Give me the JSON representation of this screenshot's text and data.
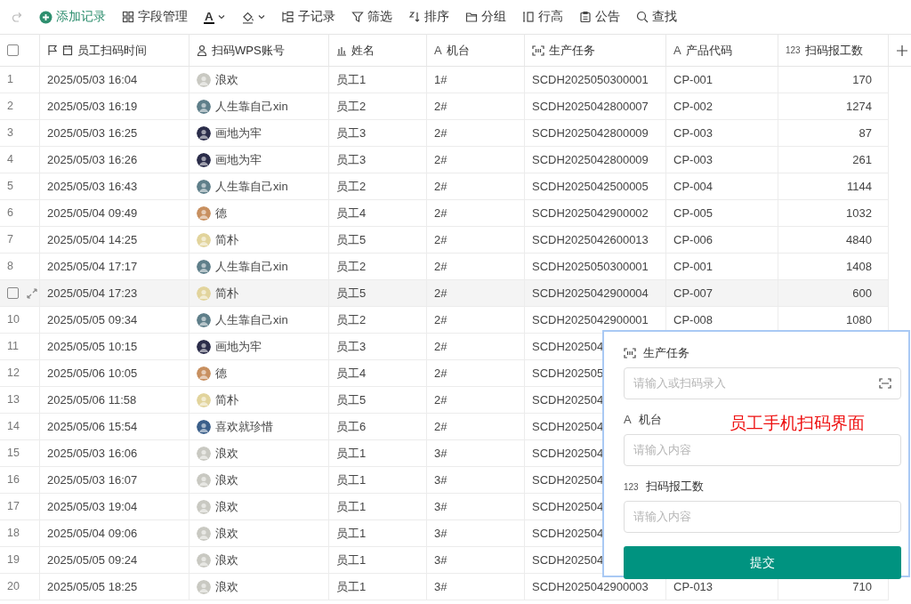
{
  "toolbar": [
    {
      "kind": "redo",
      "disabled": true
    },
    {
      "kind": "add",
      "label": "添加记录"
    },
    {
      "kind": "fields",
      "label": "字段管理"
    },
    {
      "kind": "text-color",
      "glyph": "A"
    },
    {
      "kind": "fill-color"
    },
    {
      "kind": "subrecord",
      "label": "子记录"
    },
    {
      "kind": "filter",
      "label": "筛选"
    },
    {
      "kind": "sort",
      "label": "排序"
    },
    {
      "kind": "group",
      "label": "分组"
    },
    {
      "kind": "row-height",
      "label": "行高"
    },
    {
      "kind": "notice",
      "label": "公告"
    },
    {
      "kind": "search",
      "label": "查找"
    }
  ],
  "table": {
    "all_selected": false,
    "columns": [
      {
        "kind": "date",
        "label": "员工扫码时间"
      },
      {
        "kind": "person",
        "label": "扫码WPS账号"
      },
      {
        "kind": "chart",
        "label": "姓名"
      },
      {
        "kind": "text",
        "icon_text": "A",
        "label": "机台"
      },
      {
        "kind": "scan",
        "label": "生产任务"
      },
      {
        "kind": "text",
        "icon_text": "A",
        "label": "产品代码"
      },
      {
        "kind": "number",
        "icon_text": "123",
        "label": "扫码报工数"
      }
    ],
    "rows": [
      {
        "num": "1",
        "hovered": false,
        "time": "2025/05/03 16:04",
        "account": {
          "name": "浪欢",
          "color": "#c9c9c2"
        },
        "name": "员工1",
        "machine": "1#",
        "task": "SCDH2025050300001",
        "product": "CP-001",
        "count": "170"
      },
      {
        "num": "2",
        "hovered": false,
        "time": "2025/05/03 16:19",
        "account": {
          "name": "人生靠自己xin",
          "color": "#5f7f8a"
        },
        "name": "员工2",
        "machine": "2#",
        "task": "SCDH2025042800007",
        "product": "CP-002",
        "count": "1274"
      },
      {
        "num": "3",
        "hovered": false,
        "time": "2025/05/03 16:25",
        "account": {
          "name": "画地为牢",
          "color": "#2b2d4a"
        },
        "name": "员工3",
        "machine": "2#",
        "task": "SCDH2025042800009",
        "product": "CP-003",
        "count": "87"
      },
      {
        "num": "4",
        "hovered": false,
        "time": "2025/05/03 16:26",
        "account": {
          "name": "画地为牢",
          "color": "#2b2d4a"
        },
        "name": "员工3",
        "machine": "2#",
        "task": "SCDH2025042800009",
        "product": "CP-003",
        "count": "261"
      },
      {
        "num": "5",
        "hovered": false,
        "time": "2025/05/03 16:43",
        "account": {
          "name": "人生靠自己xin",
          "color": "#5f7f8a"
        },
        "name": "员工2",
        "machine": "2#",
        "task": "SCDH2025042500005",
        "product": "CP-004",
        "count": "1144"
      },
      {
        "num": "6",
        "hovered": false,
        "time": "2025/05/04 09:49",
        "account": {
          "name": "德",
          "color": "#c89060"
        },
        "name": "员工4",
        "machine": "2#",
        "task": "SCDH2025042900002",
        "product": "CP-005",
        "count": "1032"
      },
      {
        "num": "7",
        "hovered": false,
        "time": "2025/05/04 14:25",
        "account": {
          "name": "简朴",
          "color": "#e2d49c"
        },
        "name": "员工5",
        "machine": "2#",
        "task": "SCDH2025042600013",
        "product": "CP-006",
        "count": "4840"
      },
      {
        "num": "8",
        "hovered": false,
        "time": "2025/05/04 17:17",
        "account": {
          "name": "人生靠自己xin",
          "color": "#5f7f8a"
        },
        "name": "员工2",
        "machine": "2#",
        "task": "SCDH2025050300001",
        "product": "CP-001",
        "count": "1408"
      },
      {
        "hovered": true,
        "time": "2025/05/04 17:23",
        "account": {
          "name": "简朴",
          "color": "#e2d49c"
        },
        "name": "员工5",
        "machine": "2#",
        "task": "SCDH2025042900004",
        "product": "CP-007",
        "count": "600"
      },
      {
        "num": "10",
        "hovered": false,
        "time": "2025/05/05 09:34",
        "account": {
          "name": "人生靠自己xin",
          "color": "#5f7f8a"
        },
        "name": "员工2",
        "machine": "2#",
        "task": "SCDH2025042900001",
        "product": "CP-008",
        "count": "1080"
      },
      {
        "num": "11",
        "hovered": false,
        "time": "2025/05/05 10:15",
        "account": {
          "name": "画地为牢",
          "color": "#2b2d4a"
        },
        "name": "员工3",
        "machine": "2#",
        "task": "SCDH202504"
      },
      {
        "num": "12",
        "hovered": false,
        "time": "2025/05/06 10:05",
        "account": {
          "name": "德",
          "color": "#c89060"
        },
        "name": "员工4",
        "machine": "2#",
        "task": "SCDH202505"
      },
      {
        "num": "13",
        "hovered": false,
        "time": "2025/05/06 11:58",
        "account": {
          "name": "简朴",
          "color": "#e2d49c"
        },
        "name": "员工5",
        "machine": "2#",
        "task": "SCDH202504"
      },
      {
        "num": "14",
        "hovered": false,
        "time": "2025/05/06 15:54",
        "account": {
          "name": "喜欢就珍惜",
          "color": "#3b5f8a"
        },
        "name": "员工6",
        "machine": "2#",
        "task": "SCDH202504"
      },
      {
        "num": "15",
        "hovered": false,
        "time": "2025/05/03 16:06",
        "account": {
          "name": "浪欢",
          "color": "#c9c9c2"
        },
        "name": "员工1",
        "machine": "3#",
        "task": "SCDH202504"
      },
      {
        "num": "16",
        "hovered": false,
        "time": "2025/05/03 16:07",
        "account": {
          "name": "浪欢",
          "color": "#c9c9c2"
        },
        "name": "员工1",
        "machine": "3#",
        "task": "SCDH202504"
      },
      {
        "num": "17",
        "hovered": false,
        "time": "2025/05/03 19:04",
        "account": {
          "name": "浪欢",
          "color": "#c9c9c2"
        },
        "name": "员工1",
        "machine": "3#",
        "task": "SCDH202504"
      },
      {
        "num": "18",
        "hovered": false,
        "time": "2025/05/04 09:06",
        "account": {
          "name": "浪欢",
          "color": "#c9c9c2"
        },
        "name": "员工1",
        "machine": "3#",
        "task": "SCDH202504"
      },
      {
        "num": "19",
        "hovered": false,
        "time": "2025/05/05 09:24",
        "account": {
          "name": "浪欢",
          "color": "#c9c9c2"
        },
        "name": "员工1",
        "machine": "3#",
        "task": "SCDH202504"
      },
      {
        "num": "20",
        "hovered": false,
        "time": "2025/05/05 18:25",
        "account": {
          "name": "浪欢",
          "color": "#c9c9c2"
        },
        "name": "员工1",
        "machine": "3#",
        "task": "SCDH2025042900003",
        "product": "CP-013",
        "count": "710"
      }
    ]
  },
  "scan_form": {
    "fields": [
      {
        "kind": "scan",
        "label": "生产任务",
        "placeholder": "请输入或扫码录入"
      },
      {
        "kind": "text",
        "icon_text": "A",
        "label": "机台",
        "placeholder": "请输入内容"
      },
      {
        "kind": "number",
        "icon_text": "123",
        "label": "扫码报工数",
        "placeholder": "请输入内容"
      }
    ],
    "submit": "提交",
    "annotation": "员工手机扫码界面"
  }
}
